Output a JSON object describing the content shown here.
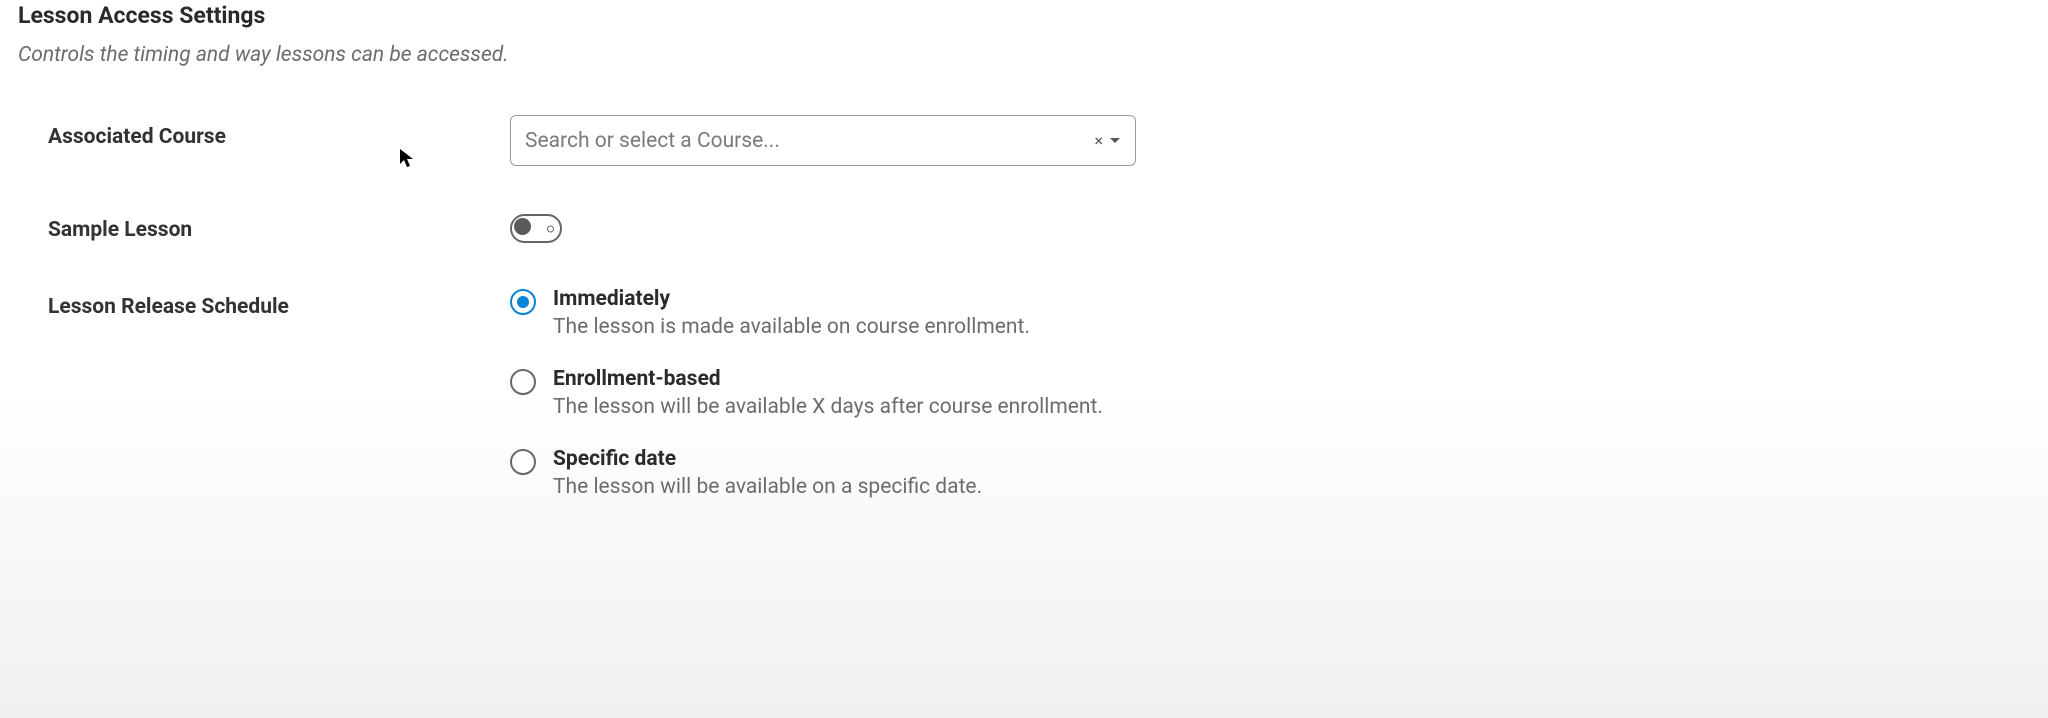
{
  "section": {
    "title": "Lesson Access Settings",
    "subtitle": "Controls the timing and way lessons can be accessed."
  },
  "fields": {
    "associated_course": {
      "label": "Associated Course",
      "placeholder": "Search or select a Course...",
      "value": "",
      "clear_glyph": "×"
    },
    "sample_lesson": {
      "label": "Sample Lesson",
      "enabled": false
    },
    "release_schedule": {
      "label": "Lesson Release Schedule",
      "selected": "immediately",
      "options": [
        {
          "id": "immediately",
          "title": "Immediately",
          "desc": "The lesson is made available on course enrollment."
        },
        {
          "id": "enrollment",
          "title": "Enrollment-based",
          "desc": "The lesson will be available X days after course enrollment."
        },
        {
          "id": "specific",
          "title": "Specific date",
          "desc": "The lesson will be available on a specific date."
        }
      ]
    }
  }
}
